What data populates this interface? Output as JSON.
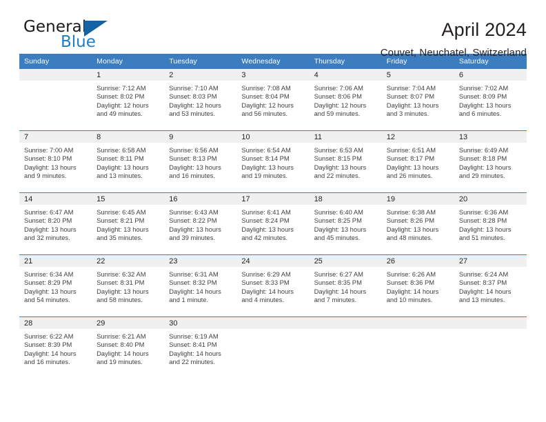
{
  "brand": {
    "name_top": "General",
    "name_bottom": "Blue",
    "triangle_color": "#1464a5",
    "blue_text_color": "#1d7cc4",
    "logo_icon": "triangle-icon"
  },
  "header": {
    "title": "April 2024",
    "subtitle": "Couvet, Neuchatel, Switzerland"
  },
  "theme": {
    "header_blue": "#3c7dbf",
    "daynum_band": "#f0f0f0",
    "text": "#231f20",
    "detail_text": "#404040"
  },
  "calendar": {
    "weekday_headers": [
      "Sunday",
      "Monday",
      "Tuesday",
      "Wednesday",
      "Thursday",
      "Friday",
      "Saturday"
    ],
    "weeks": [
      [
        {
          "day": "",
          "sunrise": "",
          "sunset": "",
          "daylight_line1": "",
          "daylight_line2": ""
        },
        {
          "day": "1",
          "sunrise": "Sunrise: 7:12 AM",
          "sunset": "Sunset: 8:02 PM",
          "daylight_line1": "Daylight: 12 hours",
          "daylight_line2": "and 49 minutes."
        },
        {
          "day": "2",
          "sunrise": "Sunrise: 7:10 AM",
          "sunset": "Sunset: 8:03 PM",
          "daylight_line1": "Daylight: 12 hours",
          "daylight_line2": "and 53 minutes."
        },
        {
          "day": "3",
          "sunrise": "Sunrise: 7:08 AM",
          "sunset": "Sunset: 8:04 PM",
          "daylight_line1": "Daylight: 12 hours",
          "daylight_line2": "and 56 minutes."
        },
        {
          "day": "4",
          "sunrise": "Sunrise: 7:06 AM",
          "sunset": "Sunset: 8:06 PM",
          "daylight_line1": "Daylight: 12 hours",
          "daylight_line2": "and 59 minutes."
        },
        {
          "day": "5",
          "sunrise": "Sunrise: 7:04 AM",
          "sunset": "Sunset: 8:07 PM",
          "daylight_line1": "Daylight: 13 hours",
          "daylight_line2": "and 3 minutes."
        },
        {
          "day": "6",
          "sunrise": "Sunrise: 7:02 AM",
          "sunset": "Sunset: 8:09 PM",
          "daylight_line1": "Daylight: 13 hours",
          "daylight_line2": "and 6 minutes."
        }
      ],
      [
        {
          "day": "7",
          "sunrise": "Sunrise: 7:00 AM",
          "sunset": "Sunset: 8:10 PM",
          "daylight_line1": "Daylight: 13 hours",
          "daylight_line2": "and 9 minutes."
        },
        {
          "day": "8",
          "sunrise": "Sunrise: 6:58 AM",
          "sunset": "Sunset: 8:11 PM",
          "daylight_line1": "Daylight: 13 hours",
          "daylight_line2": "and 13 minutes."
        },
        {
          "day": "9",
          "sunrise": "Sunrise: 6:56 AM",
          "sunset": "Sunset: 8:13 PM",
          "daylight_line1": "Daylight: 13 hours",
          "daylight_line2": "and 16 minutes."
        },
        {
          "day": "10",
          "sunrise": "Sunrise: 6:54 AM",
          "sunset": "Sunset: 8:14 PM",
          "daylight_line1": "Daylight: 13 hours",
          "daylight_line2": "and 19 minutes."
        },
        {
          "day": "11",
          "sunrise": "Sunrise: 6:53 AM",
          "sunset": "Sunset: 8:15 PM",
          "daylight_line1": "Daylight: 13 hours",
          "daylight_line2": "and 22 minutes."
        },
        {
          "day": "12",
          "sunrise": "Sunrise: 6:51 AM",
          "sunset": "Sunset: 8:17 PM",
          "daylight_line1": "Daylight: 13 hours",
          "daylight_line2": "and 26 minutes."
        },
        {
          "day": "13",
          "sunrise": "Sunrise: 6:49 AM",
          "sunset": "Sunset: 8:18 PM",
          "daylight_line1": "Daylight: 13 hours",
          "daylight_line2": "and 29 minutes."
        }
      ],
      [
        {
          "day": "14",
          "sunrise": "Sunrise: 6:47 AM",
          "sunset": "Sunset: 8:20 PM",
          "daylight_line1": "Daylight: 13 hours",
          "daylight_line2": "and 32 minutes."
        },
        {
          "day": "15",
          "sunrise": "Sunrise: 6:45 AM",
          "sunset": "Sunset: 8:21 PM",
          "daylight_line1": "Daylight: 13 hours",
          "daylight_line2": "and 35 minutes."
        },
        {
          "day": "16",
          "sunrise": "Sunrise: 6:43 AM",
          "sunset": "Sunset: 8:22 PM",
          "daylight_line1": "Daylight: 13 hours",
          "daylight_line2": "and 39 minutes."
        },
        {
          "day": "17",
          "sunrise": "Sunrise: 6:41 AM",
          "sunset": "Sunset: 8:24 PM",
          "daylight_line1": "Daylight: 13 hours",
          "daylight_line2": "and 42 minutes."
        },
        {
          "day": "18",
          "sunrise": "Sunrise: 6:40 AM",
          "sunset": "Sunset: 8:25 PM",
          "daylight_line1": "Daylight: 13 hours",
          "daylight_line2": "and 45 minutes."
        },
        {
          "day": "19",
          "sunrise": "Sunrise: 6:38 AM",
          "sunset": "Sunset: 8:26 PM",
          "daylight_line1": "Daylight: 13 hours",
          "daylight_line2": "and 48 minutes."
        },
        {
          "day": "20",
          "sunrise": "Sunrise: 6:36 AM",
          "sunset": "Sunset: 8:28 PM",
          "daylight_line1": "Daylight: 13 hours",
          "daylight_line2": "and 51 minutes."
        }
      ],
      [
        {
          "day": "21",
          "sunrise": "Sunrise: 6:34 AM",
          "sunset": "Sunset: 8:29 PM",
          "daylight_line1": "Daylight: 13 hours",
          "daylight_line2": "and 54 minutes."
        },
        {
          "day": "22",
          "sunrise": "Sunrise: 6:32 AM",
          "sunset": "Sunset: 8:31 PM",
          "daylight_line1": "Daylight: 13 hours",
          "daylight_line2": "and 58 minutes."
        },
        {
          "day": "23",
          "sunrise": "Sunrise: 6:31 AM",
          "sunset": "Sunset: 8:32 PM",
          "daylight_line1": "Daylight: 14 hours",
          "daylight_line2": "and 1 minute."
        },
        {
          "day": "24",
          "sunrise": "Sunrise: 6:29 AM",
          "sunset": "Sunset: 8:33 PM",
          "daylight_line1": "Daylight: 14 hours",
          "daylight_line2": "and 4 minutes."
        },
        {
          "day": "25",
          "sunrise": "Sunrise: 6:27 AM",
          "sunset": "Sunset: 8:35 PM",
          "daylight_line1": "Daylight: 14 hours",
          "daylight_line2": "and 7 minutes."
        },
        {
          "day": "26",
          "sunrise": "Sunrise: 6:26 AM",
          "sunset": "Sunset: 8:36 PM",
          "daylight_line1": "Daylight: 14 hours",
          "daylight_line2": "and 10 minutes."
        },
        {
          "day": "27",
          "sunrise": "Sunrise: 6:24 AM",
          "sunset": "Sunset: 8:37 PM",
          "daylight_line1": "Daylight: 14 hours",
          "daylight_line2": "and 13 minutes."
        }
      ],
      [
        {
          "day": "28",
          "sunrise": "Sunrise: 6:22 AM",
          "sunset": "Sunset: 8:39 PM",
          "daylight_line1": "Daylight: 14 hours",
          "daylight_line2": "and 16 minutes."
        },
        {
          "day": "29",
          "sunrise": "Sunrise: 6:21 AM",
          "sunset": "Sunset: 8:40 PM",
          "daylight_line1": "Daylight: 14 hours",
          "daylight_line2": "and 19 minutes."
        },
        {
          "day": "30",
          "sunrise": "Sunrise: 6:19 AM",
          "sunset": "Sunset: 8:41 PM",
          "daylight_line1": "Daylight: 14 hours",
          "daylight_line2": "and 22 minutes."
        },
        {
          "day": "",
          "sunrise": "",
          "sunset": "",
          "daylight_line1": "",
          "daylight_line2": ""
        },
        {
          "day": "",
          "sunrise": "",
          "sunset": "",
          "daylight_line1": "",
          "daylight_line2": ""
        },
        {
          "day": "",
          "sunrise": "",
          "sunset": "",
          "daylight_line1": "",
          "daylight_line2": ""
        },
        {
          "day": "",
          "sunrise": "",
          "sunset": "",
          "daylight_line1": "",
          "daylight_line2": ""
        }
      ]
    ]
  }
}
